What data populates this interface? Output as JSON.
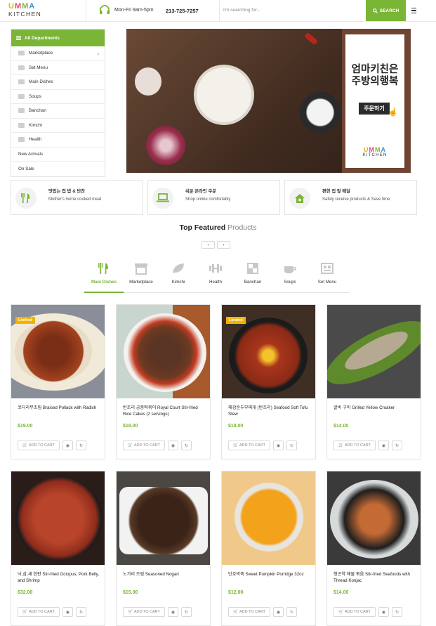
{
  "header": {
    "logo_top": "UMMA",
    "logo_bottom": "KITCHEN",
    "hours": "Mon-Fri 9am-5pm",
    "phone": "213-725-7257",
    "search_placeholder": "I'm searching for...",
    "search_button": "SEARCH"
  },
  "departments": {
    "title": "All Departments",
    "items": [
      {
        "label": "Marketplace"
      },
      {
        "label": "Set Menu"
      },
      {
        "label": "Main Dishes"
      },
      {
        "label": "Soups"
      },
      {
        "label": "Banchan"
      },
      {
        "label": "Kimchi"
      },
      {
        "label": "Health"
      },
      {
        "label": "New Arrivals"
      },
      {
        "label": "On Sale"
      }
    ]
  },
  "banner": {
    "line1": "엄마키친은",
    "line2": "주방의행복",
    "button": "주문하기",
    "logo_top": "UMMA",
    "logo_bottom": "KITCHEN"
  },
  "features": [
    {
      "title": "맛있는 집 밥 & 반찬",
      "subtitle": "Mother's home cooked meal"
    },
    {
      "title": "쉬운 온라인 주문",
      "subtitle": "Shop online comfortably"
    },
    {
      "title": "편한 집 앞 배달",
      "subtitle": "Safely receive products & Save time"
    }
  ],
  "section": {
    "title_bold": "Top Featured",
    "title_light": "Products"
  },
  "tabs": [
    {
      "label": "Main Dishes",
      "icon": "fork-knife-icon"
    },
    {
      "label": "Marketplace",
      "icon": "store-icon"
    },
    {
      "label": "Kimchi",
      "icon": "leaf-icon"
    },
    {
      "label": "Health",
      "icon": "dumbbell-icon"
    },
    {
      "label": "Banchan",
      "icon": "grid-icon"
    },
    {
      "label": "Soups",
      "icon": "cup-icon"
    },
    {
      "label": "Set Menu",
      "icon": "tray-icon"
    }
  ],
  "badge_label": "Limited",
  "add_to_cart": "ADD TO CART",
  "products": [
    {
      "name": "코다리무조림 Braised Pollack with Radish",
      "price": "$19.00",
      "limited": true
    },
    {
      "name": "반조리 궁중떡볶이 Royal Court Stir-fried Rice Cakes (2 servings)",
      "price": "$18.00",
      "limited": false
    },
    {
      "name": "해감순두부찌개 (반조리) Seafood Soft Tofu Stew",
      "price": "$18.00",
      "limited": true
    },
    {
      "name": "굴비 구이 Grilled Yellow Croaker",
      "price": "$14.00",
      "limited": false
    },
    {
      "name": "낙,삼,새 한판 Stir-fried Octopus, Pork Belly, and Shrimp",
      "price": "$32.00",
      "limited": false
    },
    {
      "name": "노가리 조림 Seasoned Nogari",
      "price": "$15.00",
      "limited": false
    },
    {
      "name": "단호박죽 Sweet Pumpkin Porridge 32oz",
      "price": "$12.00",
      "limited": false
    },
    {
      "name": "청곤약 해물 볶음 Stir-fried Seafoods with Thread Konjac",
      "price": "$14.00",
      "limited": false
    }
  ],
  "colors": {
    "accent": "#7ab536",
    "badge": "#f0b400"
  }
}
